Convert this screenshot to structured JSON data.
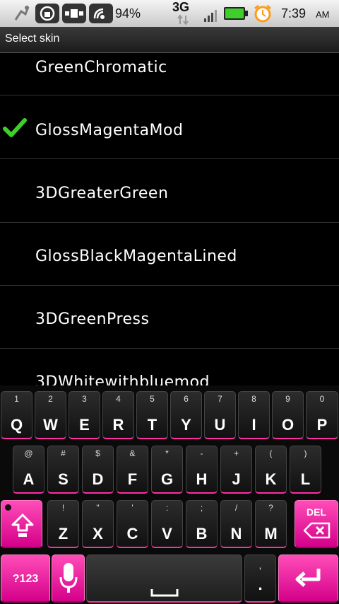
{
  "status_bar": {
    "battery_percent_label": "94%",
    "network_label": "3G",
    "time": "7:39",
    "ampm": "AM"
  },
  "title_bar": {
    "title": "Select skin"
  },
  "skins": [
    {
      "label": "GreenChromatic",
      "selected": false
    },
    {
      "label": "GlossMagentaMod",
      "selected": true
    },
    {
      "label": "3DGreaterGreen",
      "selected": false
    },
    {
      "label": "GlossBlackMagentaLined",
      "selected": false
    },
    {
      "label": "3DGreenPress",
      "selected": false
    },
    {
      "label": "3DWhitewithbluemod",
      "selected": false
    }
  ],
  "keyboard": {
    "row1": [
      {
        "main": "Q",
        "alt": "1"
      },
      {
        "main": "W",
        "alt": "2"
      },
      {
        "main": "E",
        "alt": "3"
      },
      {
        "main": "R",
        "alt": "4"
      },
      {
        "main": "T",
        "alt": "5"
      },
      {
        "main": "Y",
        "alt": "6"
      },
      {
        "main": "U",
        "alt": "7"
      },
      {
        "main": "I",
        "alt": "8"
      },
      {
        "main": "O",
        "alt": "9"
      },
      {
        "main": "P",
        "alt": "0"
      }
    ],
    "row2": [
      {
        "main": "A",
        "alt": "@"
      },
      {
        "main": "S",
        "alt": "#"
      },
      {
        "main": "D",
        "alt": "$"
      },
      {
        "main": "F",
        "alt": "&"
      },
      {
        "main": "G",
        "alt": "*"
      },
      {
        "main": "H",
        "alt": "-"
      },
      {
        "main": "J",
        "alt": "+"
      },
      {
        "main": "K",
        "alt": "("
      },
      {
        "main": "L",
        "alt": ")"
      }
    ],
    "row3": [
      {
        "main": "Z",
        "alt": "!"
      },
      {
        "main": "X",
        "alt": "\""
      },
      {
        "main": "C",
        "alt": "'"
      },
      {
        "main": "V",
        "alt": ":"
      },
      {
        "main": "B",
        "alt": ";"
      },
      {
        "main": "N",
        "alt": "/"
      },
      {
        "main": "M",
        "alt": "?"
      }
    ],
    "del_label": "DEL",
    "symbols_label": "?123",
    "comma_label": ",",
    "period_label": "."
  },
  "colors": {
    "accent": "#ff2fa3",
    "check": "#3ecf2b"
  }
}
